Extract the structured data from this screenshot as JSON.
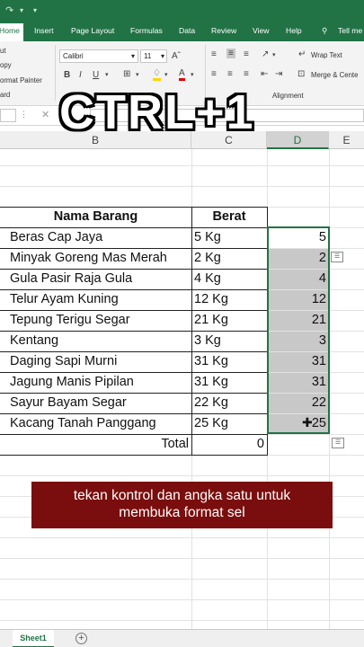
{
  "ribbon_tabs": {
    "home": "Home",
    "insert": "Insert",
    "page_layout": "Page Layout",
    "formulas": "Formulas",
    "data": "Data",
    "review": "Review",
    "view": "View",
    "help": "Help",
    "tell_me": "Tell me"
  },
  "clipboard": {
    "cut": "ut",
    "copy": "opy",
    "format_painter": "ormat Painter",
    "group": "ard"
  },
  "font": {
    "name": "Calibri",
    "size": "11"
  },
  "alignment": {
    "wrap_text": "Wrap Text",
    "merge_center": "Merge & Cente",
    "group": "Alignment"
  },
  "overlay_text": "CTRL+1",
  "columns": {
    "b": "B",
    "c": "C",
    "d": "D",
    "e": "E"
  },
  "table": {
    "header_name": "Nama Barang",
    "header_weight": "Berat",
    "rows": [
      {
        "name": "Beras Cap Jaya",
        "weight": "5 Kg",
        "value": "5"
      },
      {
        "name": "Minyak Goreng Mas Merah",
        "weight": "2 Kg",
        "value": "2"
      },
      {
        "name": "Gula Pasir Raja Gula",
        "weight": "4 Kg",
        "value": "4"
      },
      {
        "name": "Telur Ayam Kuning",
        "weight": "12 Kg",
        "value": "12"
      },
      {
        "name": "Tepung Terigu Segar",
        "weight": "21 Kg",
        "value": "21"
      },
      {
        "name": "Kentang",
        "weight": "3 Kg",
        "value": "3"
      },
      {
        "name": "Daging Sapi Murni",
        "weight": "31 Kg",
        "value": "31"
      },
      {
        "name": "Jagung Manis Pipilan",
        "weight": "31 Kg",
        "value": "31"
      },
      {
        "name": "Sayur Bayam Segar",
        "weight": "22 Kg",
        "value": "22"
      },
      {
        "name": "Kacang Tanah Panggang",
        "weight": "25 Kg",
        "value": "25"
      }
    ],
    "total_label": "Total",
    "total_value": "0"
  },
  "caption": {
    "line1": "tekan kontrol dan angka satu untuk",
    "line2": "membuka format sel"
  },
  "sheet_tab": "Sheet1",
  "colors": {
    "excel_green": "#217346",
    "caption_bg": "#7a0d0d",
    "selection_fill": "#c8c8c8"
  }
}
